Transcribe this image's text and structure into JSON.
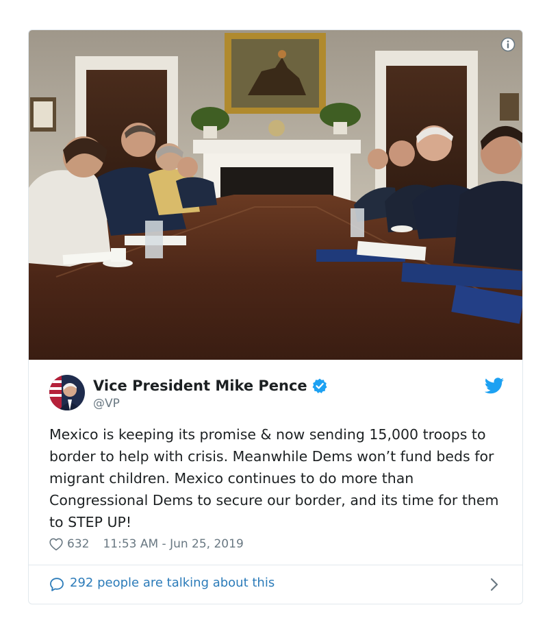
{
  "tweet": {
    "display_name": "Vice President Mike Pence",
    "handle": "@VP",
    "text": "Mexico is keeping its promise & now sending 15,000 troops to border to help with crisis. Meanwhile Dems won’t fund beds for migrant children. Mexico continues to do more than Congressional Dems to secure our border, and its time for them to STEP UP!",
    "likes": "632",
    "timestamp": "11:53 AM - Jun 25, 2019",
    "verified": true
  },
  "footer": {
    "talking_label": "292 people are talking about this"
  },
  "icons": {
    "info": "info-icon",
    "verified": "verified-badge-icon",
    "bird": "twitter-bird-icon",
    "heart": "heart-icon",
    "bubble": "speech-bubble-icon",
    "chevron": "chevron-right-icon"
  },
  "colors": {
    "twitter_blue": "#1da1f2",
    "link_blue": "#2b7bb9",
    "muted": "#697882",
    "border": "#e1e8ed",
    "text": "#1c2022"
  }
}
